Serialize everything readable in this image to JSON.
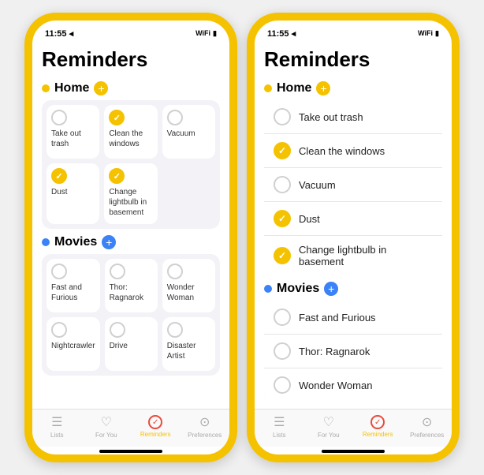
{
  "phones": [
    {
      "id": "left",
      "statusBar": {
        "time": "11:55",
        "hasSignal": true
      },
      "title": "Reminders",
      "sections": [
        {
          "id": "home",
          "label": "Home",
          "dotColor": "#F5C200",
          "addBtnColor": "#F5C200",
          "view": "grid",
          "items": [
            {
              "label": "Take out trash",
              "checked": false
            },
            {
              "label": "Clean the windows",
              "checked": true
            },
            {
              "label": "Vacuum",
              "checked": false
            },
            {
              "label": "Dust",
              "checked": true
            },
            {
              "label": "Change lightbulb in basement",
              "checked": true
            }
          ]
        },
        {
          "id": "movies",
          "label": "Movies",
          "dotColor": "#3b82f6",
          "addBtnColor": "#3b82f6",
          "view": "grid",
          "items": [
            {
              "label": "Fast and Furious",
              "checked": false
            },
            {
              "label": "Thor: Ragnarok",
              "checked": false
            },
            {
              "label": "Wonder Woman",
              "checked": false
            },
            {
              "label": "Nightcrawler",
              "checked": false
            },
            {
              "label": "Drive",
              "checked": false
            },
            {
              "label": "Disaster Artist",
              "checked": false
            }
          ]
        }
      ],
      "tabBar": {
        "tabs": [
          {
            "label": "Lists",
            "icon": "☰",
            "active": false
          },
          {
            "label": "For You",
            "icon": "♡",
            "active": false
          },
          {
            "label": "Reminders",
            "icon": "✓",
            "active": true
          },
          {
            "label": "Preferences",
            "icon": "⊙",
            "active": false
          }
        ]
      }
    },
    {
      "id": "right",
      "statusBar": {
        "time": "11:55",
        "hasSignal": true
      },
      "title": "Reminders",
      "sections": [
        {
          "id": "home",
          "label": "Home",
          "dotColor": "#F5C200",
          "addBtnColor": "#F5C200",
          "view": "list",
          "items": [
            {
              "label": "Take out trash",
              "checked": false
            },
            {
              "label": "Clean the windows",
              "checked": true
            },
            {
              "label": "Vacuum",
              "checked": false
            },
            {
              "label": "Dust",
              "checked": true
            },
            {
              "label": "Change lightbulb in basement",
              "checked": true
            }
          ]
        },
        {
          "id": "movies",
          "label": "Movies",
          "dotColor": "#3b82f6",
          "addBtnColor": "#3b82f6",
          "view": "list",
          "items": [
            {
              "label": "Fast and Furious",
              "checked": false
            },
            {
              "label": "Thor: Ragnarok",
              "checked": false
            },
            {
              "label": "Wonder Woman",
              "checked": false
            }
          ]
        }
      ],
      "tabBar": {
        "tabs": [
          {
            "label": "Lists",
            "icon": "☰",
            "active": false
          },
          {
            "label": "For You",
            "icon": "♡",
            "active": false
          },
          {
            "label": "Reminders",
            "icon": "✓",
            "active": true
          },
          {
            "label": "Preferences",
            "icon": "⊙",
            "active": false
          }
        ]
      }
    }
  ]
}
